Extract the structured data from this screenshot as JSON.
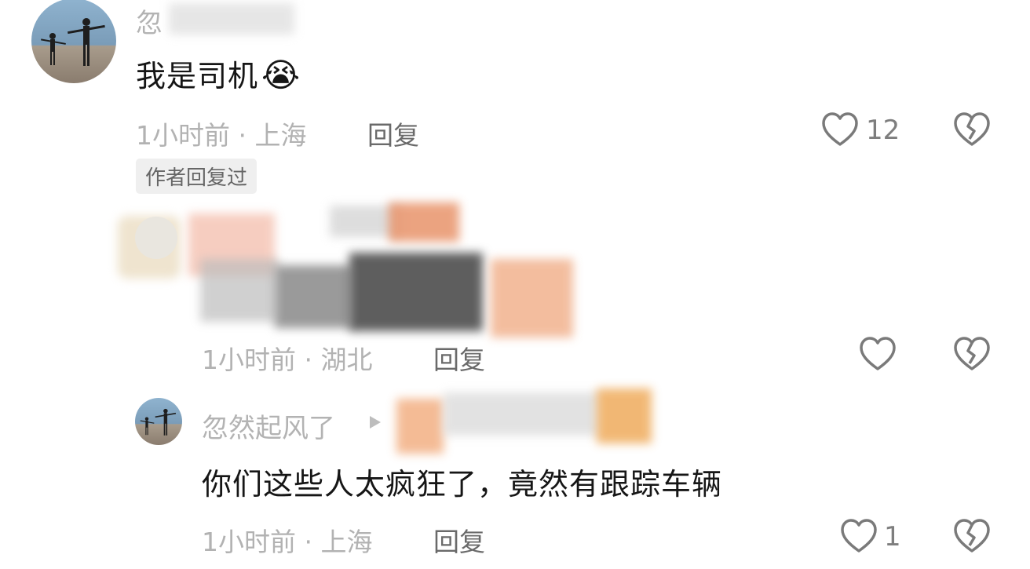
{
  "comments": [
    {
      "username": "忽",
      "text": "我是司机",
      "emoji": "😭",
      "time": "1小时前",
      "location": "上海",
      "reply_label": "回复",
      "like_count": "12",
      "badge": "作者回复过"
    },
    {
      "username": "",
      "text": "",
      "time": "1小时前",
      "location": "湖北",
      "reply_label": "回复",
      "like_count": ""
    },
    {
      "username": "忽然起风了",
      "text": "你们这些人太疯狂了，竟然有跟踪车辆",
      "time": "1小时前",
      "location": "上海",
      "reply_label": "回复",
      "like_count": "1"
    }
  ],
  "separator": "·",
  "icons": {
    "like": "heart-outline-icon",
    "dislike": "broken-heart-icon",
    "reply_arrow": "play-triangle-icon"
  },
  "colors": {
    "text": "#161616",
    "meta": "#b2b2b2",
    "reply": "#6a6a6a",
    "badge_bg": "#efefef"
  }
}
